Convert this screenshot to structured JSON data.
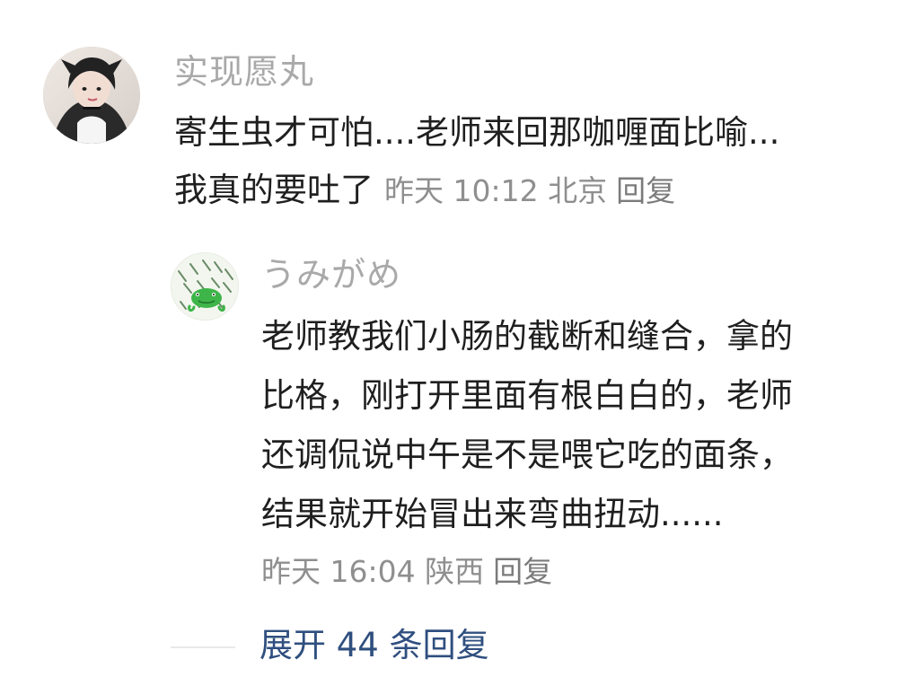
{
  "comment": {
    "username": "实现愿丸",
    "text_line1": "寄生虫才可怕....老师来回那咖喱面比喻...",
    "text_line2": "我真的要吐了",
    "time": "昨天 10:12",
    "location": "北京",
    "reply_label": "回复"
  },
  "reply": {
    "username": "うみがめ",
    "lines": [
      "老师教我们小肠的截断和缝合，拿的",
      "比格，刚打开里面有根白白的，老师",
      "还调侃说中午是不是喂它吃的面条，",
      "结果就开始冒出来弯曲扭动......"
    ],
    "time": "昨天 16:04",
    "location": "陕西",
    "reply_label": "回复"
  },
  "expand": {
    "label": "展开 44 条回复"
  },
  "icons": {
    "main_avatar": "user-avatar-icon",
    "reply_avatar": "frog-avatar-icon"
  },
  "colors": {
    "username": "#a9a9a9",
    "body_text": "#1f1f1f",
    "meta_text": "#8f8f8f",
    "expand_link": "#2f4f7f"
  }
}
